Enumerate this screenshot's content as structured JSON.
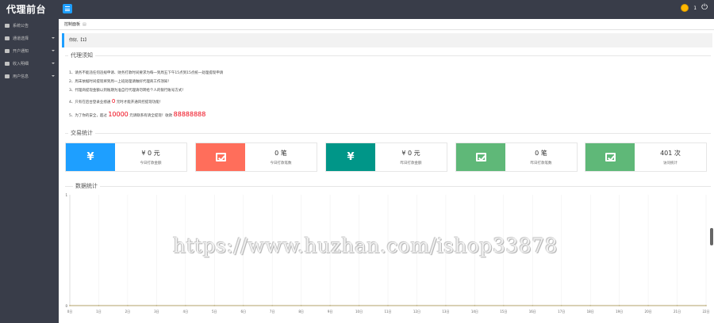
{
  "header": {
    "brand": "代理前台",
    "message_count": "1"
  },
  "sidebar": {
    "items": [
      {
        "label": "系统公告",
        "has_arrow": false
      },
      {
        "label": "通道选择",
        "has_arrow": true
      },
      {
        "label": "开户通知",
        "has_arrow": true
      },
      {
        "label": "收入明细",
        "has_arrow": true
      },
      {
        "label": "用户信息",
        "has_arrow": true
      }
    ]
  },
  "tabs": [
    {
      "label": "控制面板"
    }
  ],
  "welcome": "你好,【1】",
  "notes": {
    "title": "代理须知",
    "lines": [
      "1、请务不能违任何违规申请、财务打款时间要求为每一到周五下午15点到15点统一处理提现申请",
      "2、周末依据时间提现将到周一上班处理请做好代理商工作须知！",
      "3、代理商提现金额以到账期为准自行代理请勿转给个人的银行账号方式！",
      "4、只有在后台登录业绩通",
      "5、为了你的安全，超过",
      "元请联系有请全提现！收款"
    ],
    "line4_red": "0",
    "line4_tail": "元时才能开通风控提现功能！",
    "line5_red_amount": "10000",
    "line5_red_account": "88888888"
  },
  "stats": {
    "title": "交易统计",
    "cards": [
      {
        "icon": "yuan-icon",
        "color": "#1E9FFF",
        "value": "¥ 0 元",
        "label": "今日打款金额"
      },
      {
        "icon": "check-icon",
        "color": "#FF6E5B",
        "value": "0 笔",
        "label": "今日打款笔数"
      },
      {
        "icon": "yuan-icon",
        "color": "#009688",
        "value": "¥ 0 元",
        "label": "昨日打款金额"
      },
      {
        "icon": "check-icon",
        "color": "#5FB878",
        "value": "0 笔",
        "label": "昨日打款笔数"
      },
      {
        "icon": "check-icon",
        "color": "#5FB878",
        "value": "401 次",
        "label": "访问统计"
      }
    ]
  },
  "chart_section": {
    "title": "数据统计"
  },
  "chart_data": {
    "type": "line",
    "categories": [
      "0日",
      "1日",
      "2日",
      "3日",
      "4日",
      "5日",
      "6日",
      "7日",
      "8日",
      "9日",
      "10日",
      "11日",
      "12日",
      "13日",
      "14日",
      "15日",
      "16日",
      "17日",
      "18日",
      "19日",
      "20日",
      "21日",
      "22日"
    ],
    "series": [
      {
        "values": [
          0,
          0,
          0,
          0,
          0,
          0,
          0,
          0,
          0,
          0,
          0,
          0,
          0,
          0,
          0,
          0,
          0,
          0,
          0,
          0,
          0,
          0,
          0
        ]
      }
    ],
    "y_ticks": [
      "1",
      "0"
    ],
    "ylim": [
      0,
      1
    ],
    "grid": true,
    "line_color": "#c2b487"
  },
  "watermark": "https://www.huzhan.com/ishop33878"
}
